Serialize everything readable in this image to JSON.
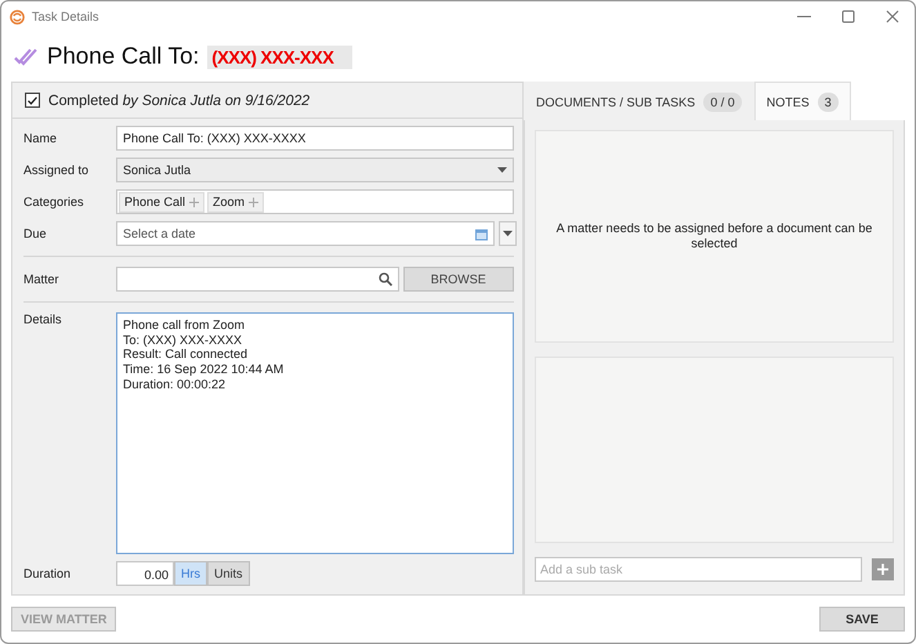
{
  "window": {
    "title": "Task Details"
  },
  "header": {
    "title": "Phone Call To:",
    "redacted_value": "(XXX) XXX-XXX"
  },
  "completion": {
    "checked": true,
    "text": "Completed *by Sonica Jutla on 9/16/2022*"
  },
  "field_groups": [
    [
      {
        "kind": "text",
        "label": "Name",
        "value": "Phone Call To: (XXX) XXX-XXXX"
      },
      {
        "kind": "dropdown",
        "label": "Assigned to",
        "value": "Sonica Jutla"
      },
      {
        "kind": "tags",
        "label": "Categories",
        "tags": [
          "Phone Call",
          "Zoom"
        ]
      },
      {
        "kind": "date",
        "label": "Due",
        "placeholder": "Select a date"
      }
    ],
    [
      {
        "kind": "search",
        "label": "Matter",
        "button": "BROWSE"
      }
    ],
    [
      {
        "kind": "textarea",
        "label": "Details",
        "value": "Phone call from Zoom\nTo: (XXX) XXX-XXXX\nResult: Call connected\nTime: 16 Sep 2022 10:44 AM\nDuration: 00:00:22"
      },
      {
        "kind": "duration",
        "label": "Duration",
        "value": "0.00",
        "units": [
          {
            "label": "Hrs",
            "selected": true
          },
          {
            "label": "Units",
            "selected": false
          }
        ]
      }
    ]
  ],
  "tabs": [
    {
      "label": "DOCUMENTS / SUB TASKS",
      "count": "0 / 0",
      "selected": true
    },
    {
      "label": "NOTES",
      "count": "3",
      "selected": false
    }
  ],
  "documents": {
    "message": "A matter needs to be assigned before a document can be selected"
  },
  "subtask": {
    "placeholder": "Add a sub task"
  },
  "footer_buttons": [
    {
      "label": "VIEW MATTER",
      "disabled": true
    },
    {
      "label": "SAVE",
      "disabled": false
    }
  ]
}
